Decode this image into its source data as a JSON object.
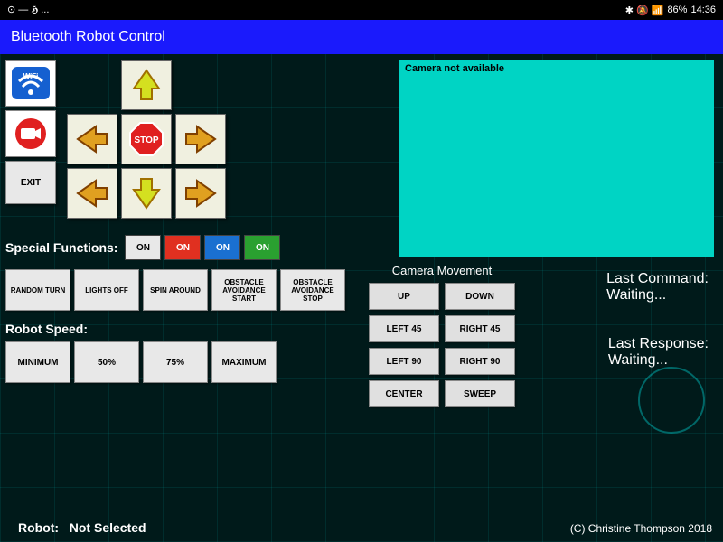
{
  "statusbar": {
    "left": "⊙ — 𝕳 ...",
    "icons": "✱ 🔕 📶",
    "battery": "86%",
    "time": "14:36"
  },
  "title": "Bluetooth Robot Control",
  "left_buttons": {
    "wifi_label": "WiFi",
    "record_label": "REC",
    "exit": "EXIT"
  },
  "dpad": {
    "stop": "STOP"
  },
  "camera": {
    "placeholder": "Camera not available"
  },
  "special": {
    "label": "Special Functions:",
    "t1": "ON",
    "t2": "ON",
    "t3": "ON",
    "t4": "ON"
  },
  "functions": [
    "RANDOM TURN",
    "LIGHTS OFF",
    "SPIN AROUND",
    "OBSTACLE AVOIDANCE START",
    "OBSTACLE AVOIDANCE STOP"
  ],
  "speed": {
    "label": "Robot Speed:",
    "options": [
      "MINIMUM",
      "50%",
      "75%",
      "MAXIMUM"
    ]
  },
  "robot": {
    "label": "Robot:",
    "value": "Not Selected"
  },
  "camera_movement": {
    "header": "Camera Movement",
    "buttons": [
      "UP",
      "DOWN",
      "LEFT 45",
      "RIGHT 45",
      "LEFT 90",
      "RIGHT 90",
      "CENTER",
      "SWEEP"
    ]
  },
  "status": {
    "cmd_label": "Last Command:",
    "cmd_val": "Waiting...",
    "resp_label": "Last Response:",
    "resp_val": "Waiting..."
  },
  "copyright": "(C) Christine Thompson 2018"
}
